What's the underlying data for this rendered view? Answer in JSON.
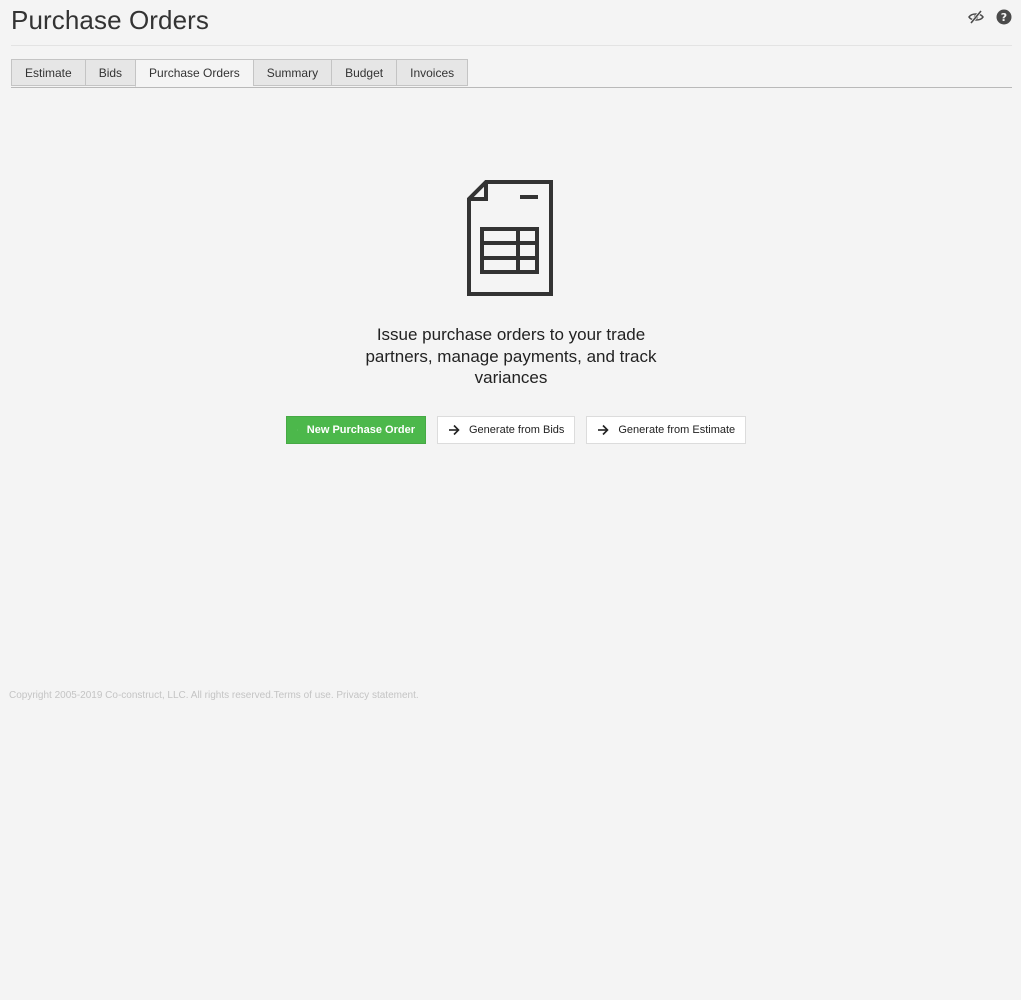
{
  "page": {
    "title": "Purchase Orders"
  },
  "header_icons": [
    "eye-slash-icon",
    "help-icon"
  ],
  "tabs": [
    {
      "label": "Estimate",
      "active": false
    },
    {
      "label": "Bids",
      "active": false
    },
    {
      "label": "Purchase Orders",
      "active": true
    },
    {
      "label": "Summary",
      "active": false
    },
    {
      "label": "Budget",
      "active": false
    },
    {
      "label": "Invoices",
      "active": false
    }
  ],
  "empty_state": {
    "icon": "document-table-icon",
    "message": "Issue purchase orders to your trade partners, manage payments, and track variances"
  },
  "actions": {
    "new_po": {
      "label": "New Purchase Order",
      "icon": "plus-icon"
    },
    "from_bids": {
      "label": "Generate from Bids",
      "icon": "arrow-right-icon"
    },
    "from_estimate": {
      "label": "Generate from Estimate",
      "icon": "arrow-right-icon"
    }
  },
  "footer": {
    "copyright": "Copyright 2005-2019 Co-construct, LLC. All rights reserved.",
    "terms": "Terms of use.",
    "privacy": "Privacy statement."
  },
  "colors": {
    "primary_button": "#4cb84b",
    "background": "#f4f4f4"
  }
}
